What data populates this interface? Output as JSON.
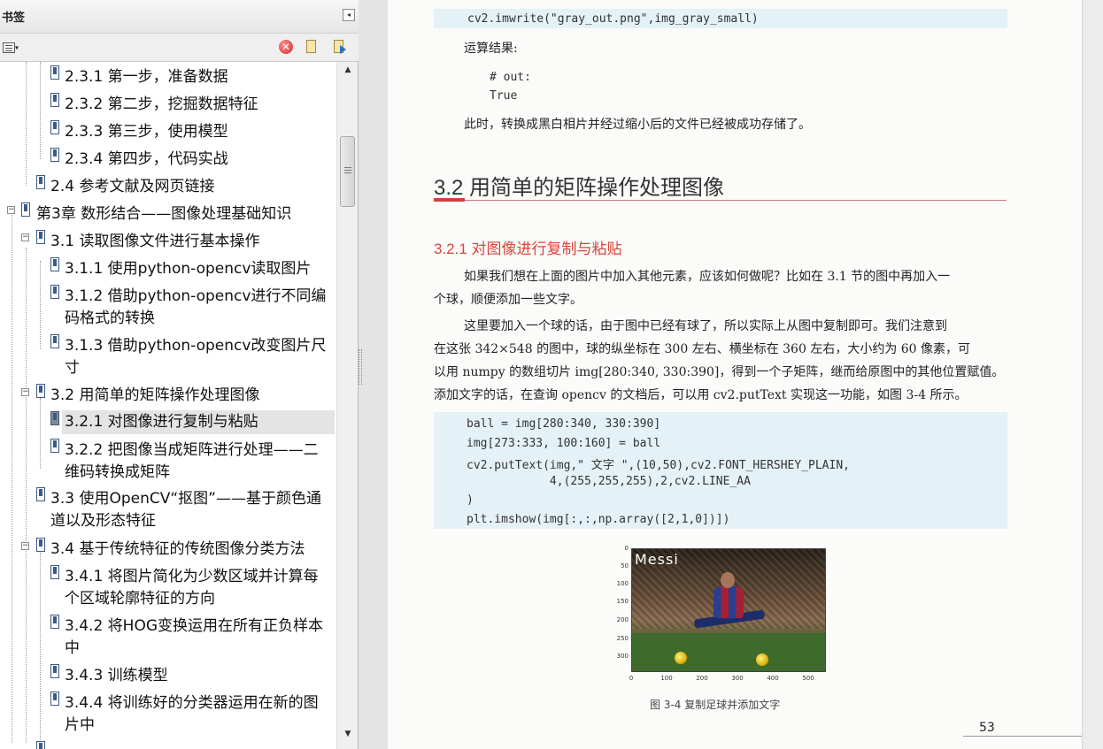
{
  "bookmarks_panel": {
    "title": "书签",
    "collapse_glyph": "◂",
    "options_caret": "▾",
    "items": [
      {
        "label": "2.3.1 第一步，准备数据",
        "level": 3
      },
      {
        "label": "2.3.2 第二步，挖掘数据特征",
        "level": 3
      },
      {
        "label": "2.3.3 第三步，使用模型",
        "level": 3
      },
      {
        "label": "2.3.4 第四步，代码实战",
        "level": 3
      },
      {
        "label": "2.4 参考文献及网页链接",
        "level": 2
      },
      {
        "label": "第3章 数形结合——图像处理基础知识",
        "level": 1,
        "expanded": true
      },
      {
        "label": "3.1 读取图像文件进行基本操作",
        "level": 2,
        "expanded": true
      },
      {
        "label": "3.1.1 使用python-opencv读取图片",
        "level": 3
      },
      {
        "label_line1": "3.1.2 借助python-opencv进行不同编",
        "label_line2": "码格式的转换",
        "level": 3
      },
      {
        "label_line1": "3.1.3 借助python-opencv改变图片尺",
        "label_line2": "寸",
        "level": 3
      },
      {
        "label": "3.2 用简单的矩阵操作处理图像",
        "level": 2,
        "expanded": true
      },
      {
        "label": "3.2.1 对图像进行复制与粘贴",
        "level": 3,
        "selected": true
      },
      {
        "label_line1": "3.2.2 把图像当成矩阵进行处理——二",
        "label_line2": "维码转换成矩阵",
        "level": 3
      },
      {
        "label_line1": "3.3 使用OpenCV“抠图”——基于颜色通",
        "label_line2": "道以及形态特征",
        "level": 2
      },
      {
        "label": "3.4 基于传统特征的传统图像分类方法",
        "level": 2,
        "expanded": true
      },
      {
        "label_line1": "3.4.1 将图片简化为少数区域并计算每",
        "label_line2": "个区域轮廓特征的方向",
        "level": 3
      },
      {
        "label_line1": "3.4.2 将HOG变换运用在所有正负样本",
        "label_line2": "中",
        "level": 3
      },
      {
        "label": "3.4.3 训练模型",
        "level": 3
      },
      {
        "label_line1": "3.4.4 将训练好的分类器运用在新的图",
        "label_line2": "片中",
        "level": 3
      }
    ],
    "toolbar": {
      "delete_glyph": "✕"
    },
    "scrollbar": {
      "up_glyph": "▲",
      "down_glyph": "▼"
    },
    "expander_open": "−"
  },
  "document": {
    "code_top": "cv2.imwrite(\"gray_out.png\",img_gray_small)",
    "result_label": "运算结果:",
    "output_lines": [
      "# out:",
      "True"
    ],
    "para_saved": "此时，转换成黑白相片并经过缩小后的文件已经被成功存储了。",
    "section_heading": "3.2  用简单的矩阵操作处理图像",
    "subsection_heading": "3.2.1  对图像进行复制与粘贴",
    "para1_line1": "如果我们想在上面的图片中加入其他元素，应该如何做呢？比如在 3.1 节的图中再加入一",
    "para1_line2": "个球，顺便添加一些文字。",
    "para2_line1": "这里要加入一个球的话，由于图中已经有球了，所以实际上从图中复制即可。我们注意到",
    "para2_line2": "在这张 342×548 的图中，球的纵坐标在 300 左右、横坐标在 360 左右，大小约为 60 像素，可",
    "para2_line3": "以用 numpy 的数组切片 img[280:340, 330:390]，得到一个子矩阵，继而给原图中的其他位置赋值。",
    "para2_line4": "添加文字的话，在查询 opencv 的文档后，可以用 cv2.putText 实现这一功能，如图 3-4 所示。",
    "code_lines": [
      "ball = img[280:340, 330:390]",
      "img[273:333, 100:160] = ball",
      "cv2.putText(img,\" 文字 \",(10,50),cv2.FONT_HERSHEY_PLAIN,",
      "            4,(255,255,255),2,cv2.LINE_AA",
      ")",
      "plt.imshow(img[:,:,np.array([2,1,0])])"
    ],
    "figure": {
      "overlay_text": "Messi",
      "y_ticks": [
        "0",
        "50",
        "100",
        "150",
        "200",
        "250",
        "300"
      ],
      "x_ticks": [
        "0",
        "100",
        "200",
        "300",
        "400",
        "500"
      ],
      "caption": "图 3-4  复制足球并添加文字"
    },
    "page_number": "53"
  }
}
